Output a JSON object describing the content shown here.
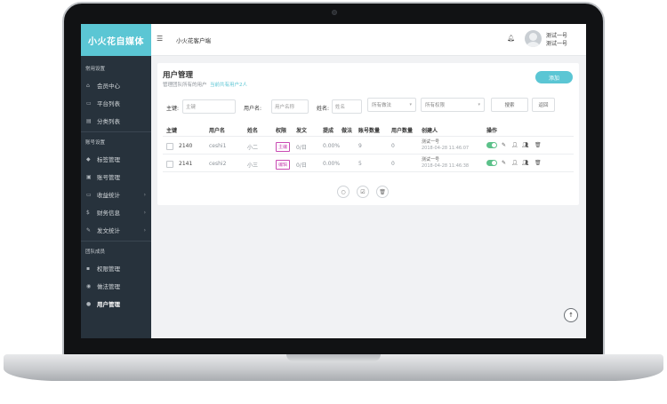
{
  "brand": "小火花自媒体",
  "header": {
    "breadcrumb": "小火花客户端",
    "user_line1": "测试一号",
    "user_line2": "测试一号"
  },
  "sidebar": {
    "sections": [
      {
        "title": "常用设置",
        "items": [
          {
            "label": "会员中心",
            "icon": "home-icon"
          },
          {
            "label": "平台列表",
            "icon": "monitor-icon"
          },
          {
            "label": "分类列表",
            "icon": "folder-icon"
          }
        ]
      },
      {
        "title": "账号设置",
        "items": [
          {
            "label": "标签管理",
            "icon": "tag-icon"
          },
          {
            "label": "账号管理",
            "icon": "id-card-icon"
          },
          {
            "label": "收益统计",
            "icon": "money-icon"
          },
          {
            "label": "财务信息",
            "icon": "dollar-icon"
          },
          {
            "label": "发文统计",
            "icon": "edit-square-icon"
          }
        ]
      },
      {
        "title": "团队成员",
        "items": [
          {
            "label": "权限管理",
            "icon": "briefcase-icon"
          },
          {
            "label": "做法管理",
            "icon": "user-shield-icon"
          },
          {
            "label": "用户管理",
            "icon": "user-icon"
          }
        ]
      }
    ]
  },
  "page": {
    "title": "用户管理",
    "subtitle": "管理团队所有的用户",
    "count_text": "当前共有用户2人",
    "add_label": "添加"
  },
  "filters": {
    "id_label": "主键:",
    "id_placeholder": "主键",
    "username_label": "用户名:",
    "username_placeholder": "用户名称",
    "name_label": "姓名:",
    "name_placeholder": "姓名",
    "method_select": "所有做法",
    "perm_select": "所有权限",
    "search_label": "搜索",
    "back_label": "返回"
  },
  "table": {
    "headers": [
      "主键",
      "用户名",
      "姓名",
      "权限",
      "发文",
      "提成",
      "做法",
      "账号数量",
      "用户数量",
      "创建人",
      "操作"
    ],
    "rows": [
      {
        "id": "2140",
        "username": "ceshi1",
        "name": "小二",
        "role": "主编",
        "posts": "0/日",
        "commission": "0.00%",
        "accounts": "9",
        "users": "0",
        "creator": "测试一号",
        "created": "2018-04-28 11:46:07"
      },
      {
        "id": "2141",
        "username": "ceshi2",
        "name": "小三",
        "role": "编辑",
        "posts": "0/日",
        "commission": "0.00%",
        "accounts": "5",
        "users": "0",
        "creator": "测试一号",
        "created": "2018-04-28 11:46:38"
      }
    ]
  }
}
